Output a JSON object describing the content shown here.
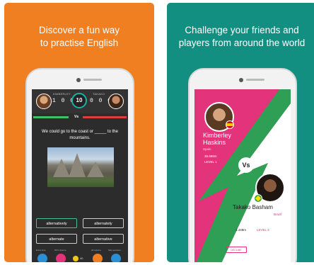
{
  "left_panel": {
    "headline_line1": "Discover a fun way",
    "headline_line2": "to practise English",
    "quiz": {
      "player1_name": "KIMBERLEY",
      "player1_score": "1 0 0",
      "round": "10",
      "player2_name": "TAKAKO",
      "player2_score": "0 0 0",
      "vs": "Vs",
      "question": "We could go to the coast or _____ to the mountains.",
      "options": [
        "alternatively",
        "alternately",
        "alternate",
        "alternative"
      ],
      "bottom_icons": [
        {
          "label": "Extra time",
          "value": "20"
        },
        {
          "label": "50% chance",
          "value": "40"
        },
        {
          "label": "",
          "value": "40"
        },
        {
          "label": "All options",
          "value": "70"
        },
        {
          "label": "Skip question",
          "value": "100"
        }
      ]
    },
    "colors": {
      "background": "#f07f22"
    }
  },
  "right_panel": {
    "headline_line1": "Challenge your friends and",
    "headline_line2": "players from around the world",
    "versus": {
      "p1_first": "Kimberley",
      "p1_last": "Haskins",
      "p1_country": "Spain",
      "p1_points": "39.999m",
      "p1_level": "LEVEL 1",
      "vs": "Vs",
      "p2_name": "Takako Basham",
      "p2_country": "Brazil",
      "p2_points": "1.449m",
      "p2_level": "LEVEL 3",
      "decline": "DECLINE"
    },
    "colors": {
      "background": "#138f82",
      "accent": "#e3337a"
    }
  }
}
